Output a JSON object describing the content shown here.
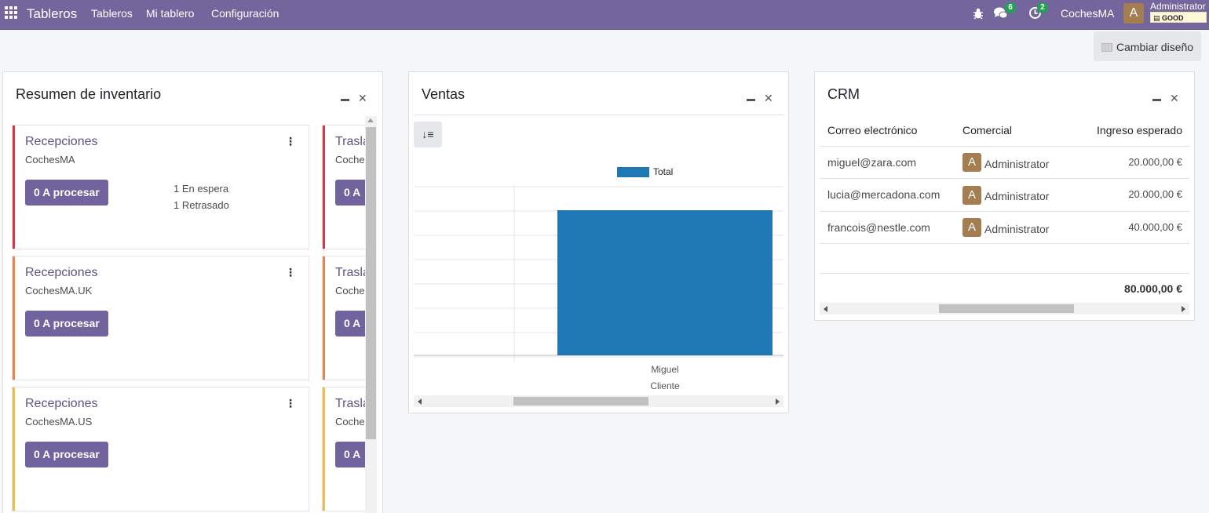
{
  "navbar": {
    "apps_icon": "grid-apps-icon",
    "brand": "Tableros",
    "menu": [
      "Tableros",
      "Mi tablero",
      "Configuración"
    ],
    "debug_icon": "bug-icon",
    "messages_icon": "chat-bubbles-icon",
    "messages_count": "6",
    "activities_icon": "clock-activity-icon",
    "activities_count": "2",
    "company": "CochesMA",
    "user_avatar": "A",
    "user_name": "Administrator",
    "db_label": "GOOD"
  },
  "layout_button": {
    "icon": "layout-icon",
    "label": "Cambiar diseño"
  },
  "inventory": {
    "title": "Resumen de inventario",
    "minimize_icon": "minimize-icon",
    "close_icon": "close-icon",
    "cards": [
      {
        "title": "Recepciones",
        "warehouse": "CochesMA",
        "button": "0 A procesar",
        "stripe_color": "#dc3545",
        "notes": [
          "1 En espera",
          "1 Retrasado"
        ]
      },
      {
        "title": "Recepciones",
        "warehouse": "CochesMA.UK",
        "button": "0 A procesar",
        "stripe_color": "#e8874a",
        "notes": []
      },
      {
        "title": "Recepciones",
        "warehouse": "CochesMA.US",
        "button": "0 A procesar",
        "stripe_color": "#e9c04d",
        "notes": []
      }
    ],
    "cards_col2": [
      {
        "title": "Trasla",
        "warehouse": "Coche",
        "button": "0 A",
        "stripe_color": "#dc3545"
      },
      {
        "title": "Trasla",
        "warehouse": "Coche",
        "button": "0 A",
        "stripe_color": "#e8874a"
      },
      {
        "title": "Trasla",
        "warehouse": "Coche",
        "button": "0 A",
        "stripe_color": "#e9c04d"
      }
    ],
    "kebab_icon": "kebab-menu-icon"
  },
  "sales": {
    "title": "Ventas",
    "sort_icon": "sort-icon",
    "sort_label": "↓≡"
  },
  "chart_data": {
    "type": "bar",
    "categories": [
      "Miguel"
    ],
    "series": [
      {
        "name": "Total",
        "values": [
          1
        ]
      }
    ],
    "xlabel": "Cliente",
    "ylabel": "",
    "legend": "top-center",
    "grid": true,
    "bar_color": "#1f77b4"
  },
  "crm": {
    "title": "CRM",
    "columns": [
      "Correo electrónico",
      "Comercial",
      "Ingreso esperado"
    ],
    "rows": [
      {
        "email": "miguel@zara.com",
        "avatar": "A",
        "salesperson": "Administrator",
        "amount": "20.000,00 €"
      },
      {
        "email": "lucia@mercadona.com",
        "avatar": "A",
        "salesperson": "Administrator",
        "amount": "20.000,00 €"
      },
      {
        "email": "francois@nestle.com",
        "avatar": "A",
        "salesperson": "Administrator",
        "amount": "40.000,00 €"
      }
    ],
    "total": "80.000,00 €"
  }
}
